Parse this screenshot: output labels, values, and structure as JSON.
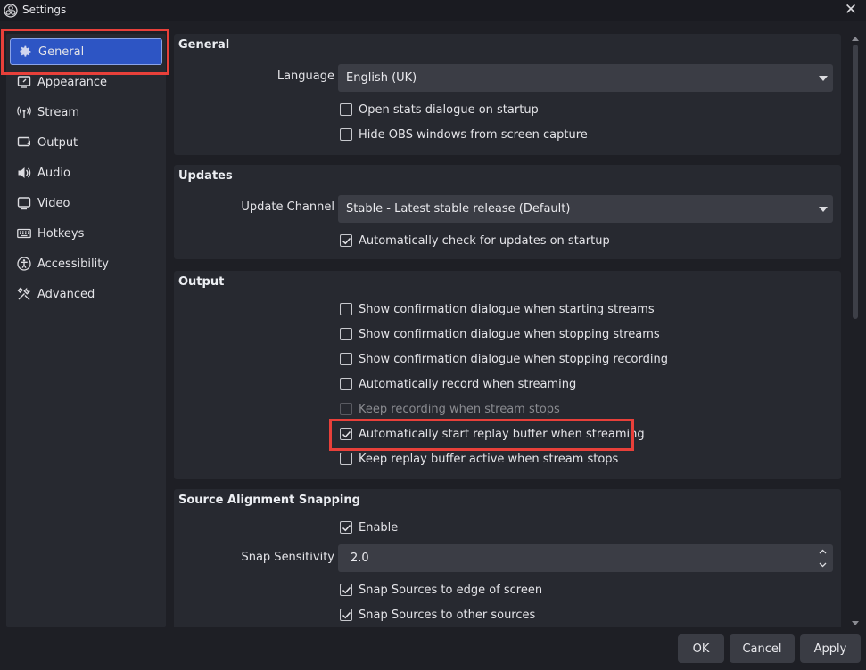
{
  "window": {
    "title": "Settings",
    "close_label": "✕"
  },
  "sidebar": {
    "items": [
      {
        "label": "General",
        "icon": "gear-icon",
        "selected": true
      },
      {
        "label": "Appearance",
        "icon": "appearance-icon"
      },
      {
        "label": "Stream",
        "icon": "antenna-icon"
      },
      {
        "label": "Output",
        "icon": "output-icon"
      },
      {
        "label": "Audio",
        "icon": "speaker-icon"
      },
      {
        "label": "Video",
        "icon": "monitor-icon"
      },
      {
        "label": "Hotkeys",
        "icon": "keyboard-icon"
      },
      {
        "label": "Accessibility",
        "icon": "accessibility-icon"
      },
      {
        "label": "Advanced",
        "icon": "tools-icon"
      }
    ]
  },
  "general_group": {
    "title": "General",
    "language_label": "Language",
    "language_value": "English (UK)",
    "open_stats": {
      "label": "Open stats dialogue on startup",
      "checked": false
    },
    "hide_obs": {
      "label": "Hide OBS windows from screen capture",
      "checked": false
    }
  },
  "updates_group": {
    "title": "Updates",
    "channel_label": "Update Channel",
    "channel_value": "Stable - Latest stable release (Default)",
    "auto_check": {
      "label": "Automatically check for updates on startup",
      "checked": true
    }
  },
  "output_group": {
    "title": "Output",
    "items": [
      {
        "label": "Show confirmation dialogue when starting streams",
        "checked": false
      },
      {
        "label": "Show confirmation dialogue when stopping streams",
        "checked": false
      },
      {
        "label": "Show confirmation dialogue when stopping recording",
        "checked": false
      },
      {
        "label": "Automatically record when streaming",
        "checked": false
      },
      {
        "label": "Keep recording when stream stops",
        "checked": false,
        "disabled": true
      },
      {
        "label": "Automatically start replay buffer when streaming",
        "checked": true
      },
      {
        "label": "Keep replay buffer active when stream stops",
        "checked": false
      }
    ]
  },
  "snapping_group": {
    "title": "Source Alignment Snapping",
    "enable": {
      "label": "Enable",
      "checked": true
    },
    "sensitivity_label": "Snap Sensitivity",
    "sensitivity_value": "2.0",
    "edge": {
      "label": "Snap Sources to edge of screen",
      "checked": true
    },
    "other": {
      "label": "Snap Sources to other sources",
      "checked": true
    }
  },
  "buttons": {
    "ok": "OK",
    "cancel": "Cancel",
    "apply": "Apply"
  },
  "colors": {
    "accent": "#2d55c4",
    "highlight": "#e8403a",
    "panel": "#272930",
    "background": "#1e1f25"
  }
}
